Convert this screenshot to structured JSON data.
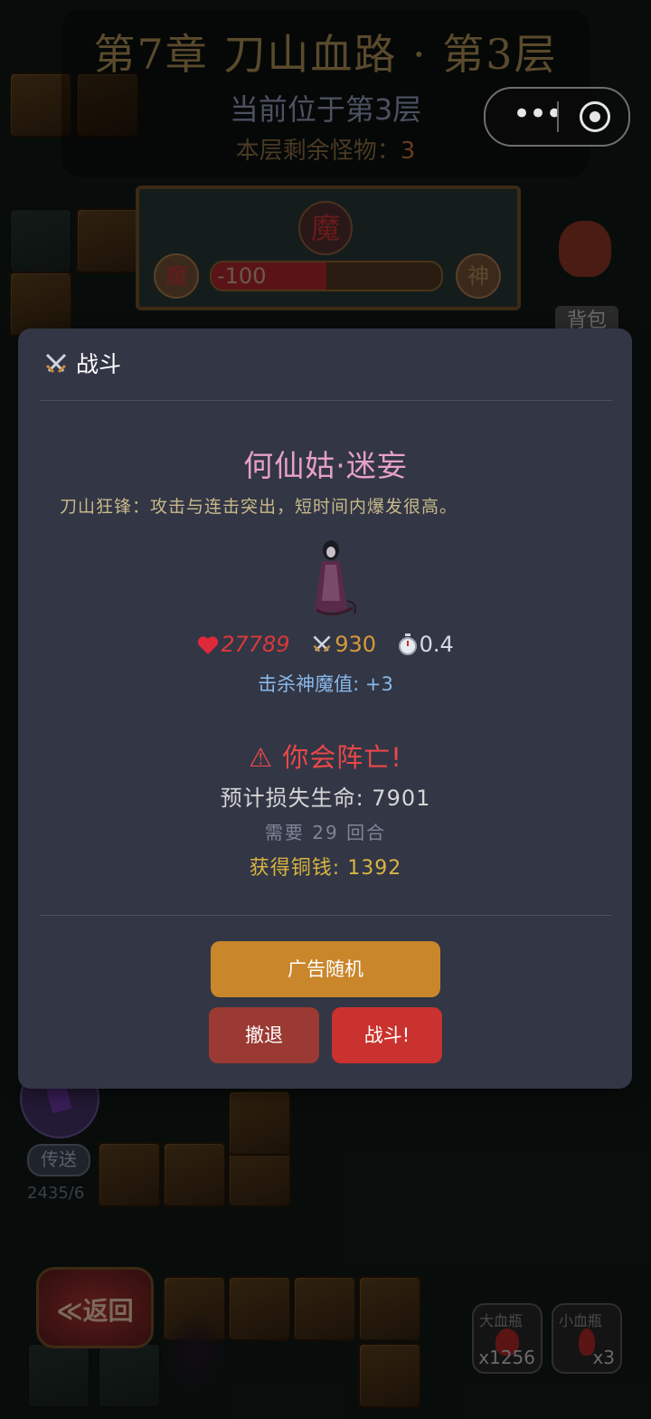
{
  "header": {
    "chapter_title": "第7章  刀山血路 · 第3层",
    "floor_status": "当前位于第3层",
    "monsters_left_label": "本层剩余怪物：",
    "monsters_left_count": "3"
  },
  "god_demon": {
    "demon_glyph": "魔",
    "left_glyph": "魔",
    "right_glyph": "神",
    "value": "-100",
    "meter_fraction": 0.5
  },
  "bag": {
    "label": "背包"
  },
  "teleport": {
    "label": "传送",
    "count": "2435/6"
  },
  "back_button": {
    "label": "返回"
  },
  "potions": {
    "big": {
      "name": "大血瓶",
      "count": "x1256"
    },
    "small": {
      "name": "小血瓶",
      "count": "x3"
    }
  },
  "dialog": {
    "title": "战斗",
    "monster_name": "何仙姑·迷妄",
    "monster_desc": "刀山狂锋：攻击与连击突出，短时间内爆发很高。",
    "hp": "27789",
    "attack": "930",
    "speed": "0.4",
    "kill_value": "击杀神魔值: +3",
    "warning": "⚠ 你会阵亡!",
    "loss": "预计损失生命: 7901",
    "rounds": "需要 29 回合",
    "coins": "获得铜钱: 1392",
    "ad_button": "广告随机",
    "retreat_button": "撤退",
    "fight_button": "战斗!"
  },
  "colors": {
    "dialog_bg": "#323645",
    "monster_name": "#e6a0c8",
    "warning": "#e84848",
    "coins": "#d8b440",
    "ad_button": "#c9862a",
    "retreat_button": "#9b3a32",
    "fight_button": "#c9322e"
  }
}
